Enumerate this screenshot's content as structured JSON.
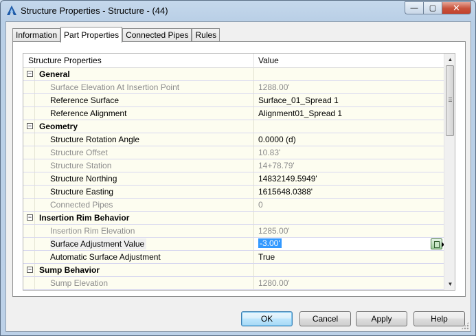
{
  "window": {
    "title": "Structure Properties - Structure - (44)",
    "controls": {
      "minimize": "—",
      "maximize": "▢",
      "close": "✕"
    }
  },
  "tabs": [
    {
      "label": "Information",
      "active": false
    },
    {
      "label": "Part Properties",
      "active": true
    },
    {
      "label": "Connected Pipes",
      "active": false
    },
    {
      "label": "Rules",
      "active": false
    }
  ],
  "grid": {
    "header": {
      "col1": "Structure Properties",
      "col2": "Value"
    },
    "rows": [
      {
        "type": "category",
        "label": "General",
        "expander": "−"
      },
      {
        "type": "prop",
        "label": "Surface Elevation At Insertion Point",
        "value": "1288.00'",
        "readonly": true
      },
      {
        "type": "prop",
        "label": "Reference Surface",
        "value": "Surface_01_Spread 1",
        "readonly": false
      },
      {
        "type": "prop",
        "label": "Reference Alignment",
        "value": "Alignment01_Spread 1",
        "readonly": false
      },
      {
        "type": "category",
        "label": "Geometry",
        "expander": "−"
      },
      {
        "type": "prop",
        "label": "Structure Rotation Angle",
        "value": "0.0000 (d)",
        "readonly": false
      },
      {
        "type": "prop",
        "label": "Structure Offset",
        "value": "10.83'",
        "readonly": true
      },
      {
        "type": "prop",
        "label": "Structure Station",
        "value": "14+78.79'",
        "readonly": true
      },
      {
        "type": "prop",
        "label": "Structure Northing",
        "value": "14832149.5949'",
        "readonly": false
      },
      {
        "type": "prop",
        "label": "Structure Easting",
        "value": "1615648.0388'",
        "readonly": false
      },
      {
        "type": "prop",
        "label": "Connected Pipes",
        "value": "0",
        "readonly": true
      },
      {
        "type": "category",
        "label": "Insertion Rim Behavior",
        "expander": "−"
      },
      {
        "type": "prop",
        "label": "Insertion Rim Elevation",
        "value": "1285.00'",
        "readonly": true
      },
      {
        "type": "prop",
        "label": "Surface Adjustment Value",
        "value": "-3.00'",
        "readonly": false,
        "editing": true
      },
      {
        "type": "prop",
        "label": "Automatic Surface Adjustment",
        "value": "True",
        "readonly": false
      },
      {
        "type": "category",
        "label": "Sump Behavior",
        "expander": "−"
      },
      {
        "type": "prop",
        "label": "Sump Elevation",
        "value": "1280.00'",
        "readonly": true
      }
    ]
  },
  "buttons": {
    "ok": "OK",
    "cancel": "Cancel",
    "apply": "Apply",
    "help": "Help"
  },
  "icons": {
    "app": "autocad-a-icon",
    "pick": "pick-from-drawing-icon"
  }
}
